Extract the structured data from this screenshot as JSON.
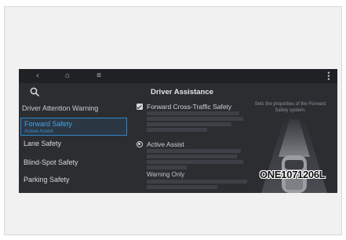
{
  "screen": {
    "title": "Driver Assistance",
    "section_heading": "Driver Attention Warning",
    "menu": [
      {
        "label": "Forward Safety",
        "sub": "Active Assist",
        "selected": true
      },
      {
        "label": "Lane Safety",
        "sub": "",
        "selected": false
      },
      {
        "label": "Blind-Spot Safety",
        "sub": "",
        "selected": false
      },
      {
        "label": "Parking Safety",
        "sub": "",
        "selected": false
      }
    ],
    "options": {
      "cross_traffic_label": "Forward Cross-Traffic Safety",
      "active_assist_label": "Active Assist",
      "warning_only_label": "Warning Only"
    },
    "hint": "Sets the properties of the Forward Safety system.",
    "icons": [
      "back-icon",
      "home-icon",
      "menu-icon",
      "more-icon",
      "search-icon"
    ]
  },
  "reference_code": "ONE1071206L",
  "colors": {
    "screen_bg": "#2b2d31",
    "accent": "#2f86c8",
    "text": "#d6d8dc"
  }
}
